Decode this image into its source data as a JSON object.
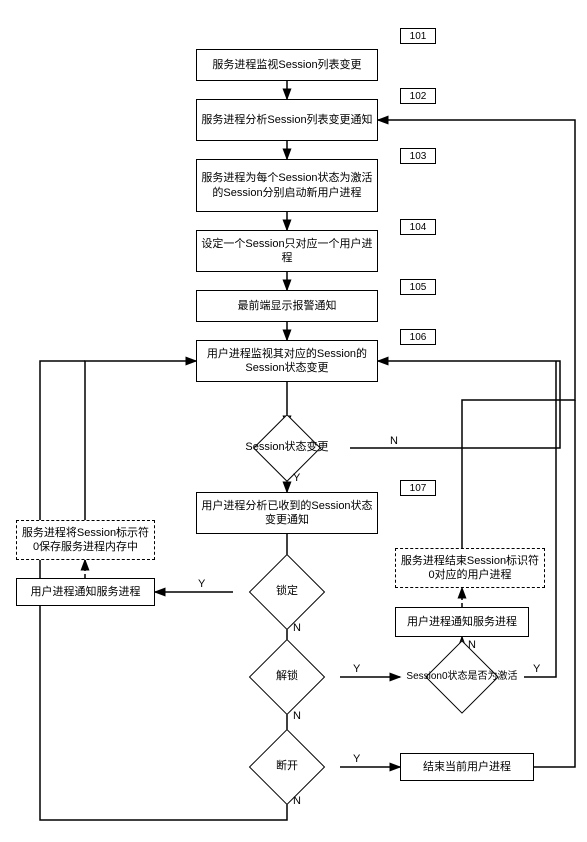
{
  "chart_data": {
    "type": "flowchart",
    "title": "",
    "nodes": [
      {
        "id": "101",
        "num": "101",
        "label": "服务进程监视Session列表变更",
        "shape": "rect"
      },
      {
        "id": "102",
        "num": "102",
        "label": "服务进程分析Session列表变更通知",
        "shape": "rect"
      },
      {
        "id": "103",
        "num": "103",
        "label": "服务进程为每个Session状态为激活的Session分别启动新用户进程",
        "shape": "rect"
      },
      {
        "id": "104",
        "num": "104",
        "label": "设定一个Session只对应一个用户进程",
        "shape": "rect"
      },
      {
        "id": "105",
        "num": "105",
        "label": "最前端显示报警通知",
        "shape": "rect"
      },
      {
        "id": "106",
        "num": "106",
        "label": "用户进程监视其对应的Session的Session状态变更",
        "shape": "rect"
      },
      {
        "id": "d1",
        "label": "Session状态变更",
        "shape": "diamond"
      },
      {
        "id": "107",
        "num": "107",
        "label": "用户进程分析已收到的Session状态变更通知",
        "shape": "rect"
      },
      {
        "id": "d2",
        "label": "锁定",
        "shape": "diamond"
      },
      {
        "id": "d3",
        "label": "解锁",
        "shape": "diamond"
      },
      {
        "id": "d4",
        "label": "断开",
        "shape": "diamond"
      },
      {
        "id": "d5",
        "label": "Session0状态是否为激活",
        "shape": "diamond"
      },
      {
        "id": "lb1",
        "label": "用户进程通知服务进程",
        "shape": "rect"
      },
      {
        "id": "lb2",
        "label": "服务进程将Session标示符0保存服务进程内存中",
        "shape": "rect",
        "dashed": true
      },
      {
        "id": "rb1",
        "label": "用户进程通知服务进程",
        "shape": "rect"
      },
      {
        "id": "rb2",
        "label": "服务进程结束Session标识符0对应的用户进程",
        "shape": "rect",
        "dashed": true
      },
      {
        "id": "rb3",
        "label": "结束当前用户进程",
        "shape": "rect"
      }
    ],
    "edges": [
      {
        "from": "101",
        "to": "102"
      },
      {
        "from": "102",
        "to": "103"
      },
      {
        "from": "103",
        "to": "104"
      },
      {
        "from": "104",
        "to": "105"
      },
      {
        "from": "105",
        "to": "106"
      },
      {
        "from": "106",
        "to": "d1"
      },
      {
        "from": "d1",
        "to": "107",
        "label": "Y"
      },
      {
        "from": "d1",
        "to": "106",
        "label": "N"
      },
      {
        "from": "107",
        "to": "d2"
      },
      {
        "from": "d2",
        "to": "lb1",
        "label": "Y"
      },
      {
        "from": "d2",
        "to": "d3",
        "label": "N"
      },
      {
        "from": "lb1",
        "to": "lb2"
      },
      {
        "from": "lb2",
        "to": "106"
      },
      {
        "from": "d3",
        "to": "d5",
        "label": "Y"
      },
      {
        "from": "d3",
        "to": "d4",
        "label": "N"
      },
      {
        "from": "d5",
        "to": "rb1",
        "label": "N"
      },
      {
        "from": "d5",
        "to": "106",
        "label": "Y"
      },
      {
        "from": "rb1",
        "to": "rb2"
      },
      {
        "from": "rb2",
        "to": "102"
      },
      {
        "from": "d4",
        "to": "rb3",
        "label": "Y"
      },
      {
        "from": "d4",
        "to": "106",
        "label": "N"
      },
      {
        "from": "rb3",
        "to": "102"
      }
    ],
    "labels": {
      "Y": "Y",
      "N": "N"
    }
  }
}
